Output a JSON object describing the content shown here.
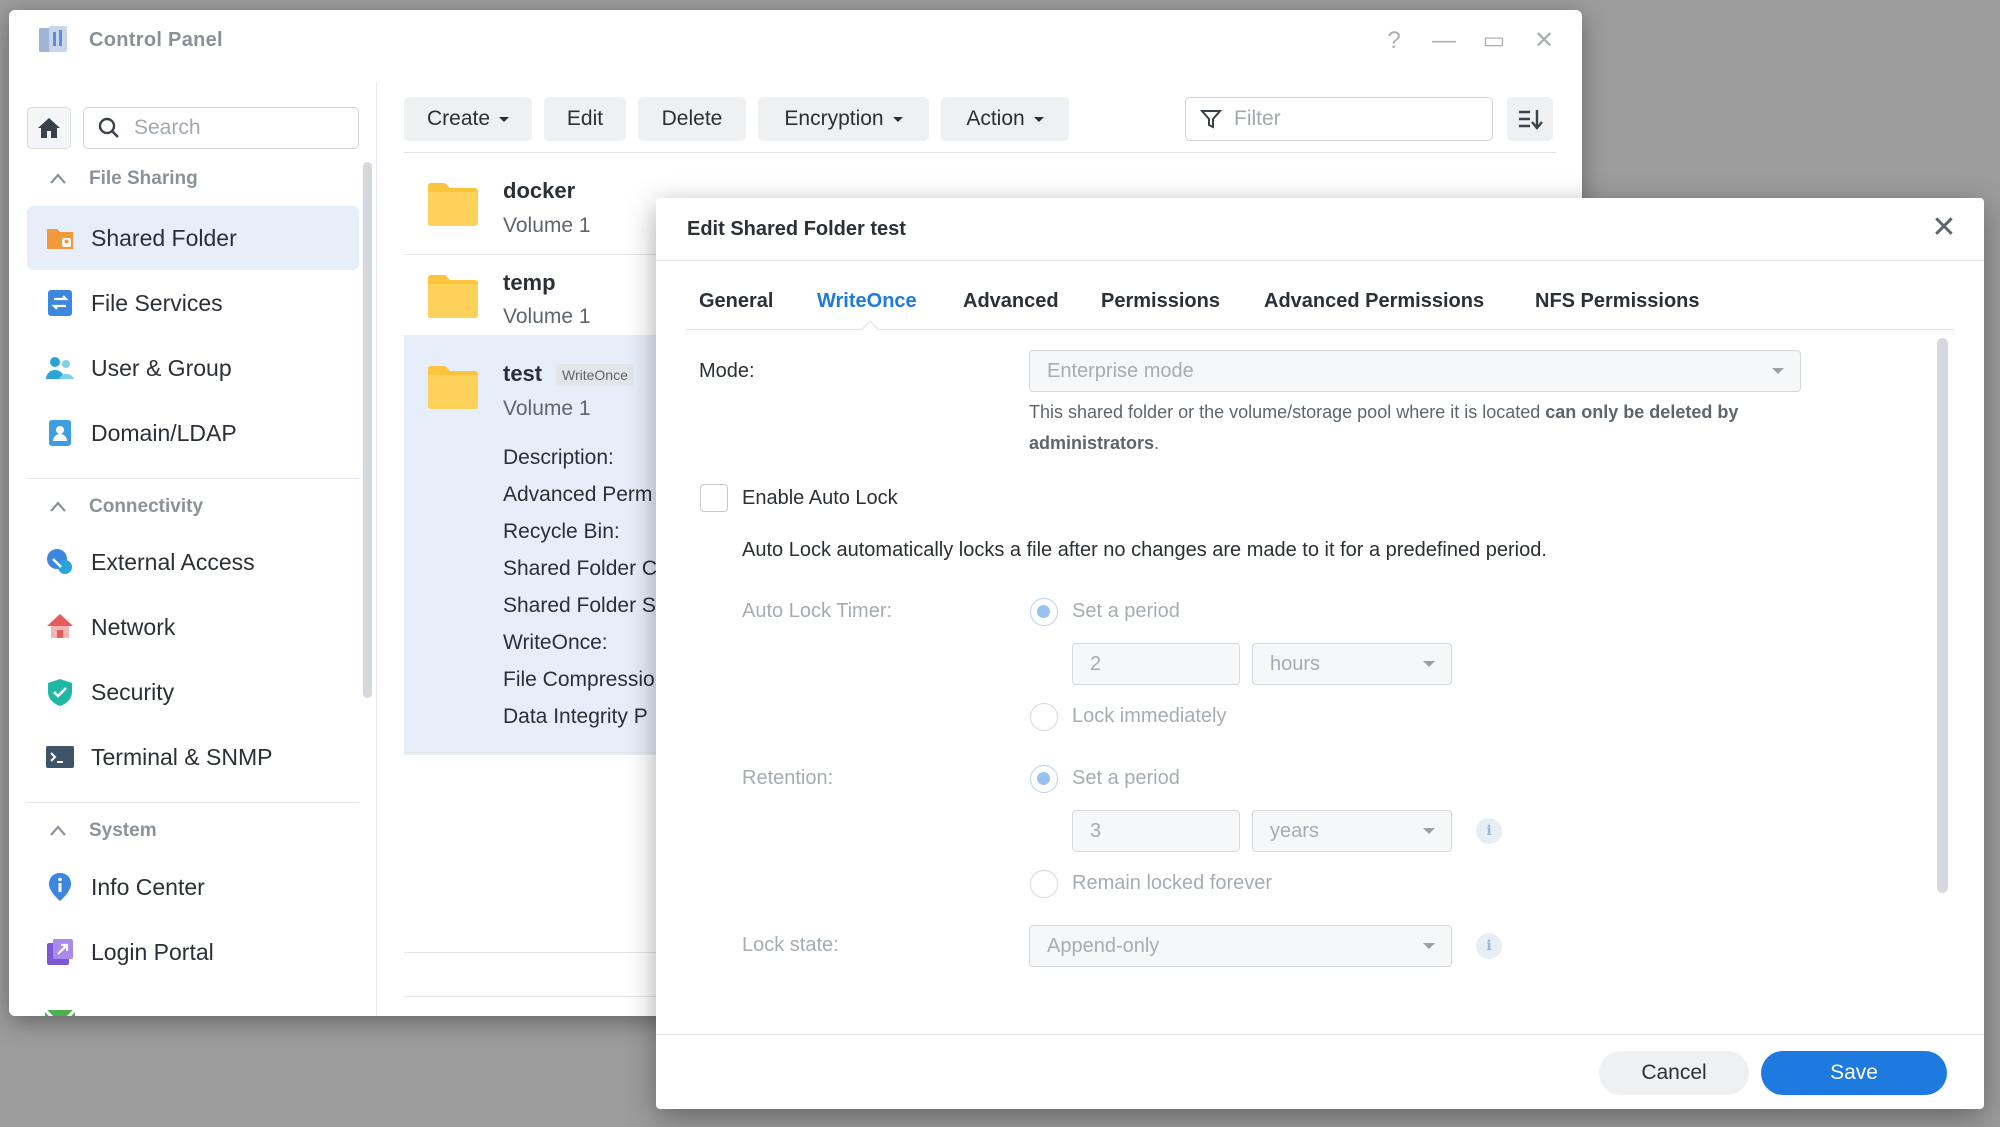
{
  "window": {
    "title": "Control Panel",
    "help": "?",
    "minimize": "—",
    "maximize": "▭",
    "close": "✕"
  },
  "sidebar": {
    "search_placeholder": "Search",
    "sections": [
      {
        "label": "File Sharing",
        "items": [
          "Shared Folder",
          "File Services",
          "User & Group",
          "Domain/LDAP"
        ]
      },
      {
        "label": "Connectivity",
        "items": [
          "External Access",
          "Network",
          "Security",
          "Terminal & SNMP"
        ]
      },
      {
        "label": "System",
        "items": [
          "Info Center",
          "Login Portal"
        ]
      }
    ],
    "active_item": "Shared Folder"
  },
  "toolbar": {
    "create": "Create",
    "edit": "Edit",
    "delete": "Delete",
    "encryption": "Encryption",
    "action": "Action",
    "filter_placeholder": "Filter"
  },
  "folders": [
    {
      "name": "docker",
      "volume": "Volume 1"
    },
    {
      "name": "temp",
      "volume": "Volume 1"
    },
    {
      "name": "test",
      "volume": "Volume 1",
      "tag": "WriteOnce",
      "details": [
        "Description:",
        "Advanced Perm",
        "Recycle Bin:",
        "Shared Folder C",
        "Shared Folder S",
        "WriteOnce:",
        "File Compressio",
        "Data Integrity P"
      ]
    }
  ],
  "dialog": {
    "title": "Edit Shared Folder test",
    "close": "✕",
    "tabs": [
      "General",
      "WriteOnce",
      "Advanced",
      "Permissions",
      "Advanced Permissions",
      "NFS Permissions"
    ],
    "active_tab": "WriteOnce",
    "mode_label": "Mode:",
    "mode_value": "Enterprise mode",
    "mode_help_prefix": "This shared folder or the volume/storage pool where it is located ",
    "mode_help_bold": "can only be deleted by administrators",
    "mode_help_suffix": ".",
    "auto_lock_label": "Enable Auto Lock",
    "auto_lock_checked": false,
    "auto_lock_desc": "Auto Lock automatically locks a file after no changes are made to it for a predefined period.",
    "timer_label": "Auto Lock Timer:",
    "timer_set_period": "Set a period",
    "timer_value": "2",
    "timer_unit": "hours",
    "timer_immediate": "Lock immediately",
    "retention_label": "Retention:",
    "retention_set_period": "Set a period",
    "retention_value": "3",
    "retention_unit": "years",
    "retention_forever": "Remain locked forever",
    "lock_state_label": "Lock state:",
    "lock_state_value": "Append-only",
    "info_glyph": "i",
    "cancel": "Cancel",
    "save": "Save"
  },
  "colors": {
    "accent": "#1f7ae0",
    "selected_bg": "#e6eef9",
    "folder": "#fbc43b"
  }
}
